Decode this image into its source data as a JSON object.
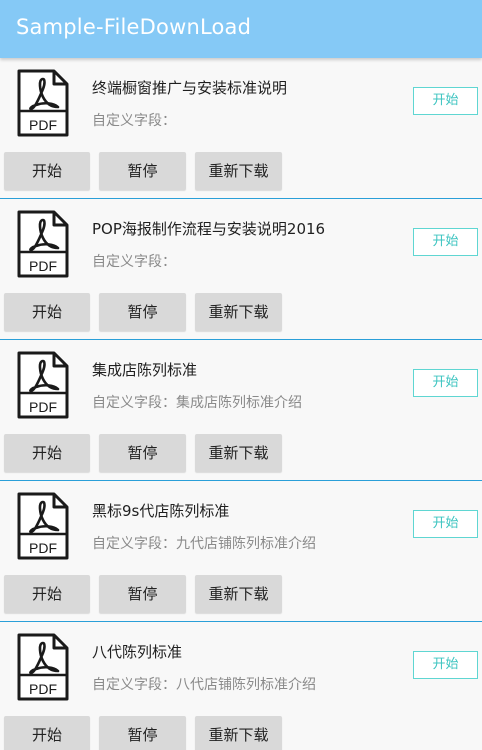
{
  "appbar": {
    "title": "Sample-FileDownLoad"
  },
  "icon": {
    "name": "pdf-file-icon",
    "label": "PDF"
  },
  "buttons": {
    "start": "开始",
    "pause": "暂停",
    "redownload": "重新下载"
  },
  "items": [
    {
      "title": "终端橱窗推广与安装标准说明",
      "subtitle": "自定义字段：",
      "side_button": "开始"
    },
    {
      "title": "POP海报制作流程与安装说明2016",
      "subtitle": "自定义字段：",
      "side_button": "开始"
    },
    {
      "title": "集成店陈列标准",
      "subtitle": "自定义字段：集成店陈列标准介绍",
      "side_button": "开始"
    },
    {
      "title": "黑标9s代店陈列标准",
      "subtitle": "自定义字段：九代店铺陈列标准介绍",
      "side_button": "开始"
    },
    {
      "title": "八代陈列标准",
      "subtitle": "自定义字段：八代店铺陈列标准介绍",
      "side_button": "开始"
    }
  ],
  "colors": {
    "appbar": "#85c9f6",
    "divider": "#2a9fd8",
    "side_button_accent": "#3cc4c0"
  }
}
